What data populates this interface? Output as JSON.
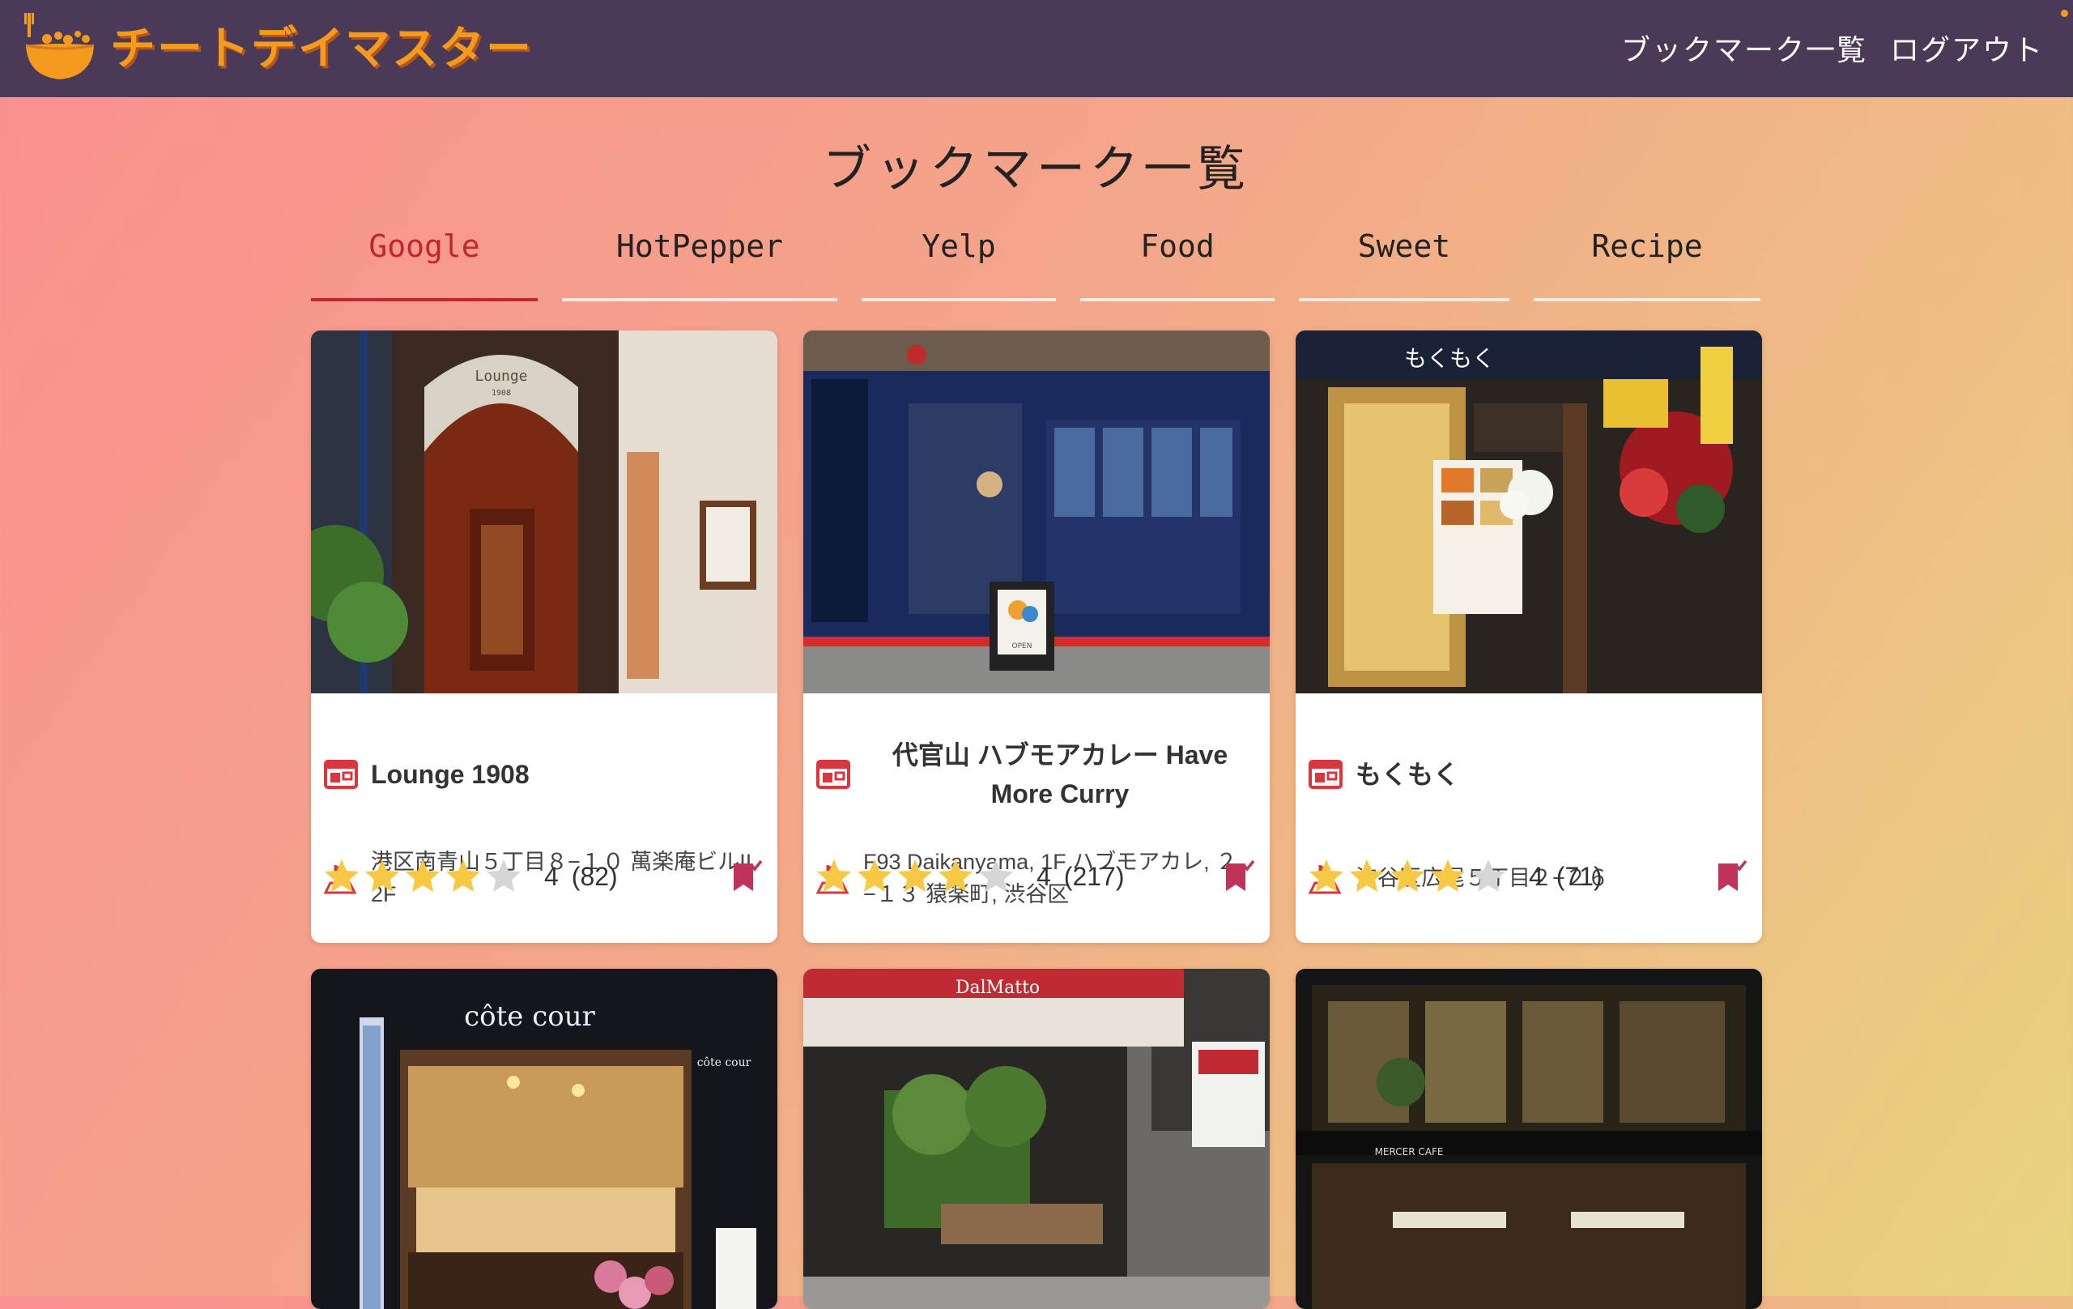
{
  "header": {
    "brand": "チートデイマスター",
    "nav": {
      "bookmarks": "ブックマーク一覧",
      "logout": "ログアウト"
    }
  },
  "page": {
    "title": "ブックマーク一覧"
  },
  "tabs": [
    {
      "label": "Google",
      "active": true
    },
    {
      "label": "HotPepper"
    },
    {
      "label": "Yelp"
    },
    {
      "label": "Food"
    },
    {
      "label": "Sweet"
    },
    {
      "label": "Recipe"
    }
  ],
  "cards": [
    {
      "name": "Lounge 1908",
      "address": "港区南青山５丁目８−１０ 萬楽庵ビルII 2F",
      "rating": "4",
      "count": "(82)",
      "stars": 4
    },
    {
      "name": "代官山 ハブモアカレー Have More Curry",
      "address": "F93 Daikanyama, 1F ハブモアカレ, ２−１３ 猿楽町, 渋谷区",
      "rating": "4",
      "count": "(217)",
      "stars": 4
    },
    {
      "name": "もくもく",
      "address": "渋谷区広尾５丁目２−２６",
      "rating": "4",
      "count": "(71)",
      "stars": 4
    },
    {
      "sign": "côte cour",
      "sign_small": "côte cour"
    },
    {
      "sign": "DalMatto"
    },
    {
      "sign": "MERCER CAFE"
    }
  ],
  "photo_signs": {
    "lounge_awning": "Lounge",
    "lounge_year": "1908",
    "mokumoku_sign": "もくもく",
    "curry_sign": "OPEN"
  },
  "colors": {
    "header_bg": "#4a3a57",
    "brand_orange": "#f39a1f",
    "tab_active": "#c0272d",
    "icon_red": "#d9363e",
    "star_gold": "#f7c843",
    "star_empty": "#d6d6d6",
    "bookmark": "#c0325a"
  }
}
